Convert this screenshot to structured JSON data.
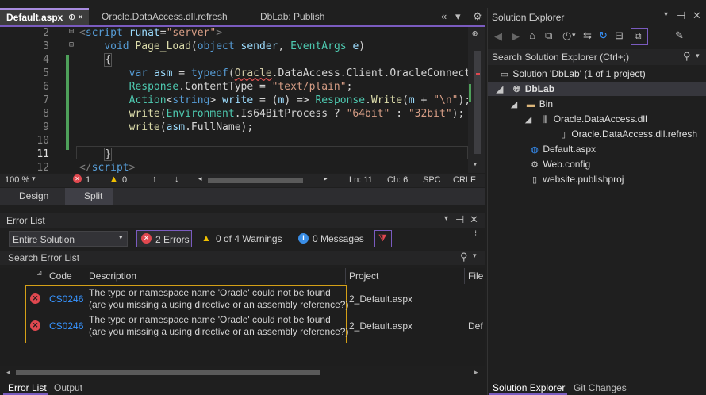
{
  "editor": {
    "tabs": [
      "Default.aspx",
      "Oracle.DataAccess.dll.refresh",
      "DbLab: Publish"
    ],
    "active_tab_pin": "⊕ ×",
    "lines": [
      {
        "n": "2"
      },
      {
        "n": "3"
      },
      {
        "n": "4"
      },
      {
        "n": "5"
      },
      {
        "n": "6"
      },
      {
        "n": "7"
      },
      {
        "n": "8"
      },
      {
        "n": "9"
      },
      {
        "n": "10"
      },
      {
        "n": "11"
      },
      {
        "n": "12"
      }
    ],
    "status": {
      "zoom": "100 %",
      "errors": "1",
      "warnings": "0",
      "line": "Ln: 11",
      "col": "Ch: 6",
      "spc": "SPC",
      "eol": "CRLF"
    },
    "design_tab": "Design",
    "split_tab": "Split"
  },
  "error_list": {
    "title": "Error List",
    "scope": "Entire Solution",
    "errors_btn": "2 Errors",
    "warnings_btn": "0 of 4 Warnings",
    "messages_btn": "0 Messages",
    "search_placeholder": "Search Error List",
    "columns": {
      "code": "Code",
      "description": "Description",
      "project": "Project",
      "file": "File"
    },
    "rows": [
      {
        "code": "CS0246",
        "desc1": "The type or namespace name 'Oracle' could not be found",
        "desc2": "(are you missing a using directive or an assembly reference?)",
        "project": "2_Default.aspx",
        "file": ""
      },
      {
        "code": "CS0246",
        "desc1": "The type or namespace name 'Oracle' could not be found",
        "desc2": "(are you missing a using directive or an assembly reference?)",
        "project": "2_Default.aspx",
        "file": "Def"
      }
    ],
    "bottom_tabs": [
      "Error List",
      "Output"
    ]
  },
  "solution_explorer": {
    "title": "Solution Explorer",
    "search_placeholder": "Search Solution Explorer (Ctrl+;)",
    "tree": [
      {
        "label": "Solution 'DbLab' (1 of 1 project)"
      },
      {
        "label": "DbLab"
      },
      {
        "label": "Bin"
      },
      {
        "label": "Oracle.DataAccess.dll"
      },
      {
        "label": "Oracle.DataAccess.dll.refresh"
      },
      {
        "label": "Default.aspx"
      },
      {
        "label": "Web.config"
      },
      {
        "label": "website.publishproj"
      }
    ],
    "bottom_tabs": [
      "Solution Explorer",
      "Git Changes"
    ]
  },
  "colors": {
    "accent": "#7a5bbf",
    "error_red": "#e0484f",
    "highlight": "#d4a017"
  }
}
